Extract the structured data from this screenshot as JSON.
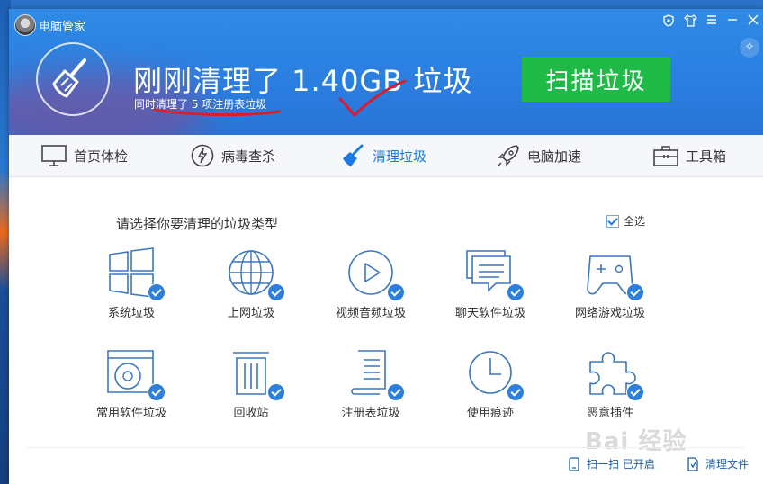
{
  "window": {
    "title": "电脑管家"
  },
  "header": {
    "headline": "刚刚清理了 1.40GB 垃圾",
    "subline": "同时清理了 5 项注册表垃圾",
    "scan_button": "扫描垃圾",
    "accent": "#1fba47"
  },
  "tabs": [
    {
      "label": "首页体检",
      "icon": "monitor-icon"
    },
    {
      "label": "病毒查杀",
      "icon": "lightning-icon"
    },
    {
      "label": "清理垃圾",
      "icon": "broom-icon",
      "active": true
    },
    {
      "label": "电脑加速",
      "icon": "rocket-icon"
    },
    {
      "label": "工具箱",
      "icon": "toolbox-icon"
    }
  ],
  "content": {
    "title": "请选择你要清理的垃圾类型",
    "select_all": "全选",
    "items": [
      {
        "label": "系统垃圾",
        "icon": "windows-icon"
      },
      {
        "label": "上网垃圾",
        "icon": "globe-icon"
      },
      {
        "label": "视频音频垃圾",
        "icon": "play-icon"
      },
      {
        "label": "聊天软件垃圾",
        "icon": "chat-icon"
      },
      {
        "label": "网络游戏垃圾",
        "icon": "gamepad-icon"
      },
      {
        "label": "常用软件垃圾",
        "icon": "disc-icon"
      },
      {
        "label": "回收站",
        "icon": "trash-icon"
      },
      {
        "label": "注册表垃圾",
        "icon": "document-icon"
      },
      {
        "label": "使用痕迹",
        "icon": "clock-icon"
      },
      {
        "label": "恶意插件",
        "icon": "puzzle-icon"
      }
    ]
  },
  "footer": {
    "scan_toggle": "扫一扫 已开启",
    "clean_file": "清理文件"
  },
  "watermark": "Bai 经验"
}
